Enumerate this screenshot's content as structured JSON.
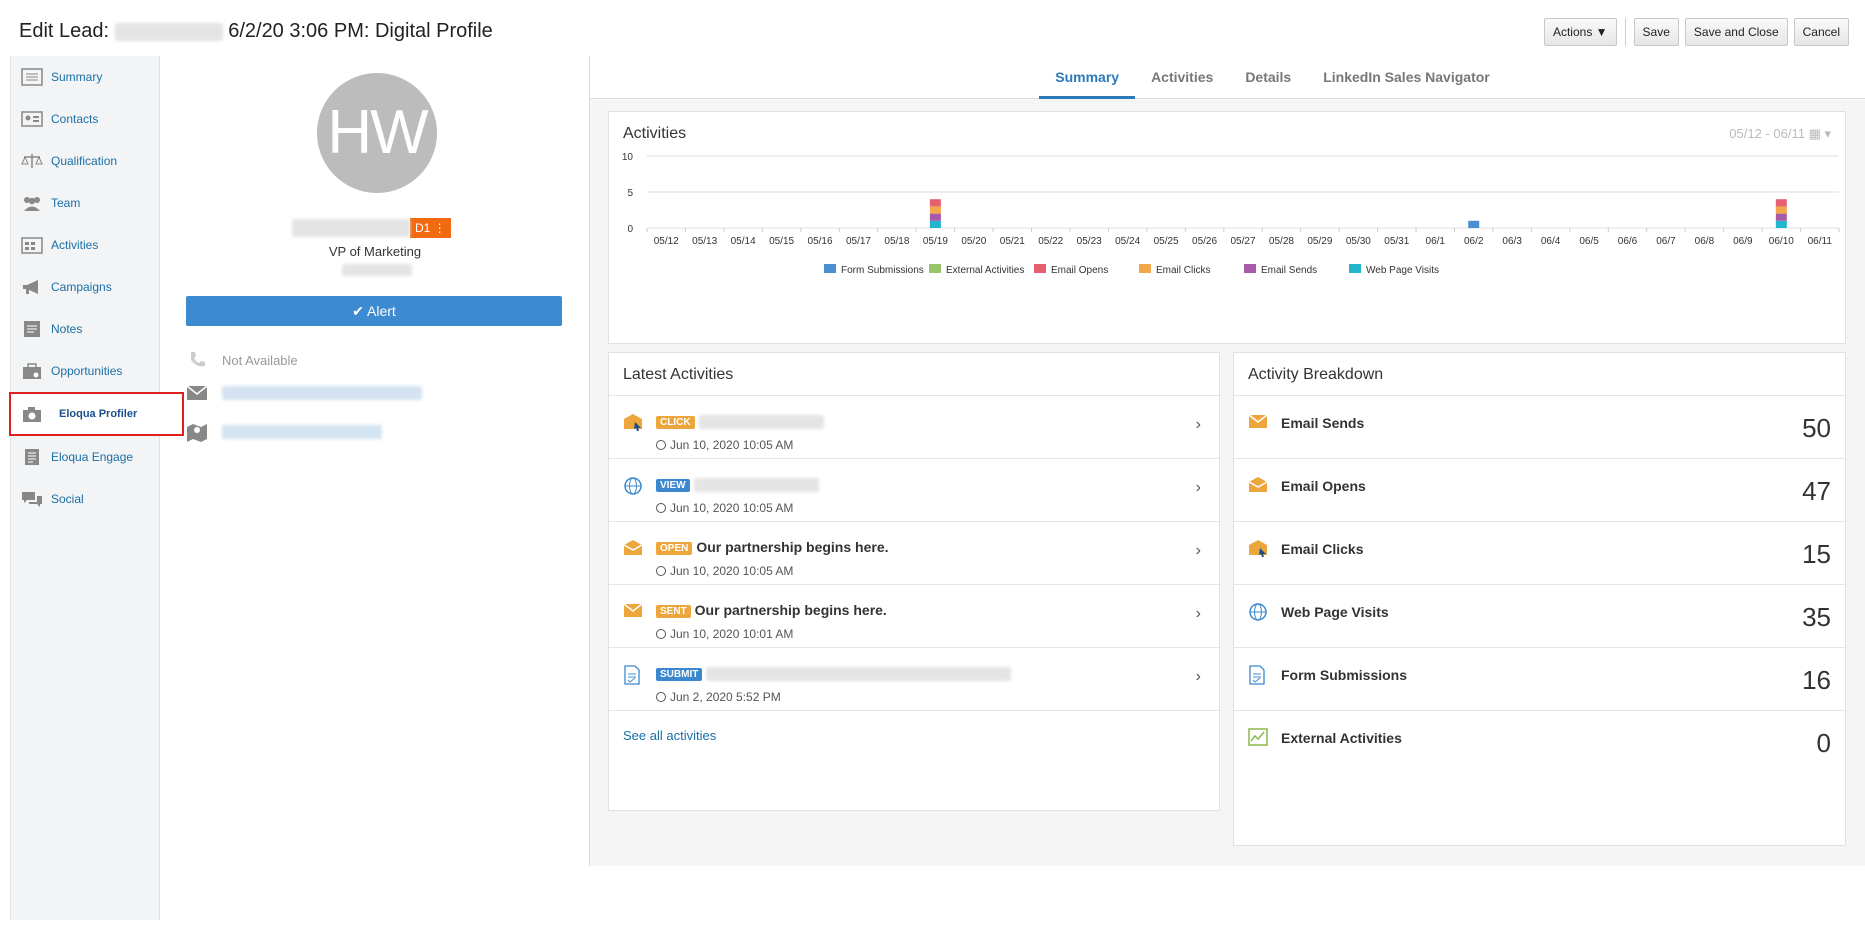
{
  "header": {
    "prefix": "Edit Lead:",
    "suffix": "6/2/20 3:06 PM",
    "sep": ":",
    "name": "Digital Profile",
    "buttons": {
      "actions": "Actions",
      "save": "Save",
      "save_close": "Save and Close",
      "cancel": "Cancel"
    }
  },
  "nav": [
    {
      "label": "Summary",
      "icon": "summary-icon"
    },
    {
      "label": "Contacts",
      "icon": "contacts-icon"
    },
    {
      "label": "Qualification",
      "icon": "scales-icon"
    },
    {
      "label": "Team",
      "icon": "team-icon"
    },
    {
      "label": "Activities",
      "icon": "activities-icon"
    },
    {
      "label": "Campaigns",
      "icon": "megaphone-icon"
    },
    {
      "label": "Notes",
      "icon": "notes-icon"
    },
    {
      "label": "Opportunities",
      "icon": "briefcase-icon"
    },
    {
      "label": "Eloqua Profiler",
      "icon": "camera-icon"
    },
    {
      "label": "Eloqua Engage",
      "icon": "document-icon"
    },
    {
      "label": "Social",
      "icon": "chat-icon"
    }
  ],
  "profile": {
    "initials": "HW",
    "badge": "D1",
    "title": "VP of Marketing",
    "alert": "Alert",
    "phone": "Not Available"
  },
  "tabs": [
    "Summary",
    "Activities",
    "Details",
    "LinkedIn Sales Navigator"
  ],
  "activities_chart": {
    "title": "Activities",
    "range": "05/12 - 06/11",
    "chart_data": {
      "type": "bar",
      "stacked": true,
      "categories": [
        "05/12",
        "05/13",
        "05/14",
        "05/15",
        "05/16",
        "05/17",
        "05/18",
        "05/19",
        "05/20",
        "05/21",
        "05/22",
        "05/23",
        "05/24",
        "05/25",
        "05/26",
        "05/27",
        "05/28",
        "05/29",
        "05/30",
        "05/31",
        "06/1",
        "06/2",
        "06/3",
        "06/4",
        "06/5",
        "06/6",
        "06/7",
        "06/8",
        "06/9",
        "06/10",
        "06/11"
      ],
      "ylim": [
        0,
        10
      ],
      "yticks": [
        0,
        5,
        10
      ],
      "series": [
        {
          "name": "Form Submissions",
          "color": "#4a8fd0",
          "values": [
            0,
            0,
            0,
            0,
            0,
            0,
            0,
            0,
            0,
            0,
            0,
            0,
            0,
            0,
            0,
            0,
            0,
            0,
            0,
            0,
            0,
            1,
            0,
            0,
            0,
            0,
            0,
            0,
            0,
            0,
            0
          ]
        },
        {
          "name": "External Activities",
          "color": "#98c46a",
          "values": [
            0,
            0,
            0,
            0,
            0,
            0,
            0,
            0,
            0,
            0,
            0,
            0,
            0,
            0,
            0,
            0,
            0,
            0,
            0,
            0,
            0,
            0,
            0,
            0,
            0,
            0,
            0,
            0,
            0,
            0,
            0
          ]
        },
        {
          "name": "Email Opens",
          "color": "#e85f73",
          "values": [
            0,
            0,
            0,
            0,
            0,
            0,
            0,
            1,
            0,
            0,
            0,
            0,
            0,
            0,
            0,
            0,
            0,
            0,
            0,
            0,
            0,
            0,
            0,
            0,
            0,
            0,
            0,
            0,
            0,
            1,
            0
          ]
        },
        {
          "name": "Email Clicks",
          "color": "#f0a84a",
          "values": [
            0,
            0,
            0,
            0,
            0,
            0,
            0,
            1,
            0,
            0,
            0,
            0,
            0,
            0,
            0,
            0,
            0,
            0,
            0,
            0,
            0,
            0,
            0,
            0,
            0,
            0,
            0,
            0,
            0,
            1,
            0
          ]
        },
        {
          "name": "Email Sends",
          "color": "#a85aa8",
          "values": [
            0,
            0,
            0,
            0,
            0,
            0,
            0,
            1,
            0,
            0,
            0,
            0,
            0,
            0,
            0,
            0,
            0,
            0,
            0,
            0,
            0,
            0,
            0,
            0,
            0,
            0,
            0,
            0,
            0,
            1,
            0
          ]
        },
        {
          "name": "Web Page Visits",
          "color": "#23b5cc",
          "values": [
            0,
            0,
            0,
            0,
            0,
            0,
            0,
            1,
            0,
            0,
            0,
            0,
            0,
            0,
            0,
            0,
            0,
            0,
            0,
            0,
            0,
            0,
            0,
            0,
            0,
            0,
            0,
            0,
            0,
            1,
            0
          ]
        }
      ],
      "legend": "bottom"
    }
  },
  "latest": {
    "title": "Latest Activities",
    "items": [
      {
        "tag": "CLICK",
        "color": "orange",
        "text": "",
        "date": "Jun 10, 2020 10:05 AM",
        "icon": "email-click-icon"
      },
      {
        "tag": "VIEW",
        "color": "blue",
        "text": "",
        "date": "Jun 10, 2020 10:05 AM",
        "icon": "globe-icon"
      },
      {
        "tag": "OPEN",
        "color": "orange",
        "text": "Our partnership begins here.",
        "date": "Jun 10, 2020 10:05 AM",
        "icon": "email-open-icon"
      },
      {
        "tag": "SENT",
        "color": "orange",
        "text": "Our partnership begins here.",
        "date": "Jun 10, 2020 10:01 AM",
        "icon": "email-icon"
      },
      {
        "tag": "SUBMIT",
        "color": "blue",
        "text": "",
        "date": "Jun 2, 2020 5:52 PM",
        "icon": "form-icon"
      }
    ],
    "see_all": "See all activities"
  },
  "breakdown": {
    "title": "Activity Breakdown",
    "items": [
      {
        "label": "Email Sends",
        "value": "50",
        "icon": "email-icon"
      },
      {
        "label": "Email Opens",
        "value": "47",
        "icon": "email-open-icon"
      },
      {
        "label": "Email Clicks",
        "value": "15",
        "icon": "email-click-icon"
      },
      {
        "label": "Web Page Visits",
        "value": "35",
        "icon": "globe-icon"
      },
      {
        "label": "Form Submissions",
        "value": "16",
        "icon": "form-icon"
      },
      {
        "label": "External Activities",
        "value": "0",
        "icon": "chart-icon"
      }
    ]
  }
}
